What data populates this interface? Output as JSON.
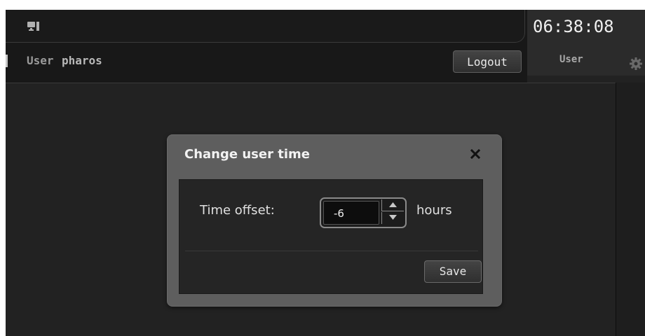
{
  "header": {
    "user_label": "User",
    "user_name": "pharos",
    "logout_label": "Logout",
    "clock": "06:38:08",
    "clock_user_label": "User",
    "icons": [
      "monitor-icon",
      "gear-icon"
    ]
  },
  "dialog": {
    "title": "Change user time",
    "close_icon": "close-icon",
    "offset_label": "Time offset:",
    "offset_value": "-6",
    "unit_label": "hours",
    "save_label": "Save"
  },
  "colors": {
    "background": "#222222",
    "header": "#181818",
    "dialog_frame": "#5e5e5e",
    "dialog_body": "#252525",
    "text": "#e0e0e0"
  }
}
